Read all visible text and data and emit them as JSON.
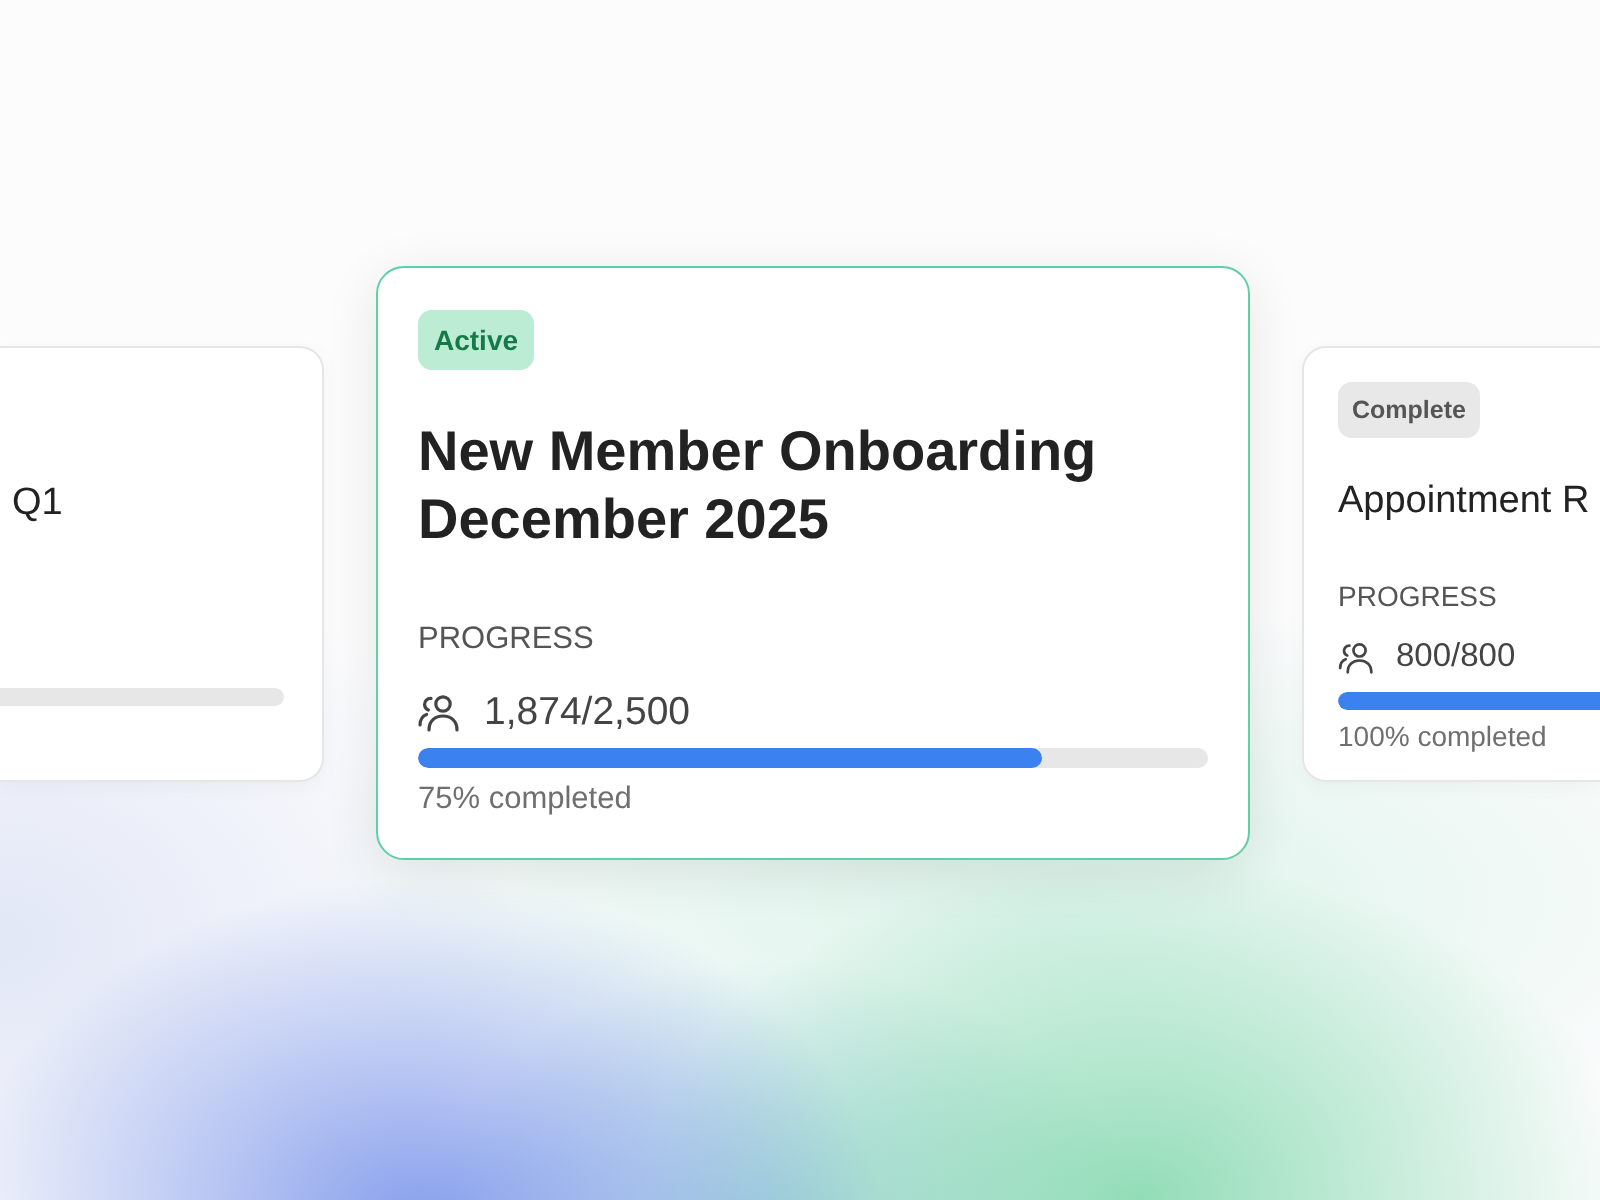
{
  "cards": [
    {
      "selected": false,
      "title": "Q1",
      "progress": {
        "fill_shown": false
      }
    },
    {
      "selected": true,
      "status": {
        "label": "Active",
        "kind": "active"
      },
      "title": "New Member Onboarding December 2025",
      "progress": {
        "label": "PROGRESS",
        "count": "1,874/2,500",
        "level": 0.79,
        "caption": "75% completed"
      }
    },
    {
      "selected": false,
      "status": {
        "label": "Complete",
        "kind": "complete"
      },
      "title": "Appointment R",
      "progress": {
        "label": "PROGRESS",
        "count": "800/800",
        "level": 1,
        "caption": "100% completed"
      }
    }
  ]
}
